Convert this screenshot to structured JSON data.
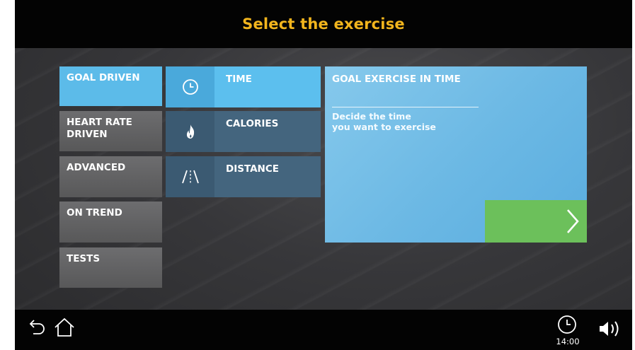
{
  "header": {
    "title": "Select the exercise"
  },
  "categories": [
    {
      "label": "GOAL DRIVEN",
      "active": true
    },
    {
      "label": "HEART RATE\nDRIVEN",
      "active": false
    },
    {
      "label": "ADVANCED",
      "active": false
    },
    {
      "label": "ON TREND",
      "active": false
    },
    {
      "label": "TESTS",
      "active": false
    }
  ],
  "options": [
    {
      "label": "TIME",
      "icon": "clock-icon",
      "active": true
    },
    {
      "label": "CALORIES",
      "icon": "flame-icon",
      "active": false
    },
    {
      "label": "DISTANCE",
      "icon": "road-icon",
      "active": false
    }
  ],
  "detail": {
    "title": "GOAL EXERCISE IN TIME",
    "description_line1": "Decide the time",
    "description_line2": "you want to exercise",
    "next_icon": "chevron-right-icon"
  },
  "footer": {
    "back_icon": "back-arrow-icon",
    "home_icon": "home-icon",
    "clock_icon": "clock-icon",
    "time": "14:00",
    "volume_icon": "volume-icon"
  },
  "colors": {
    "header_title": "#f2b51d",
    "active_blue": "#5cbbe9",
    "next_green": "#6cc05b",
    "category_gray": "#626264"
  }
}
